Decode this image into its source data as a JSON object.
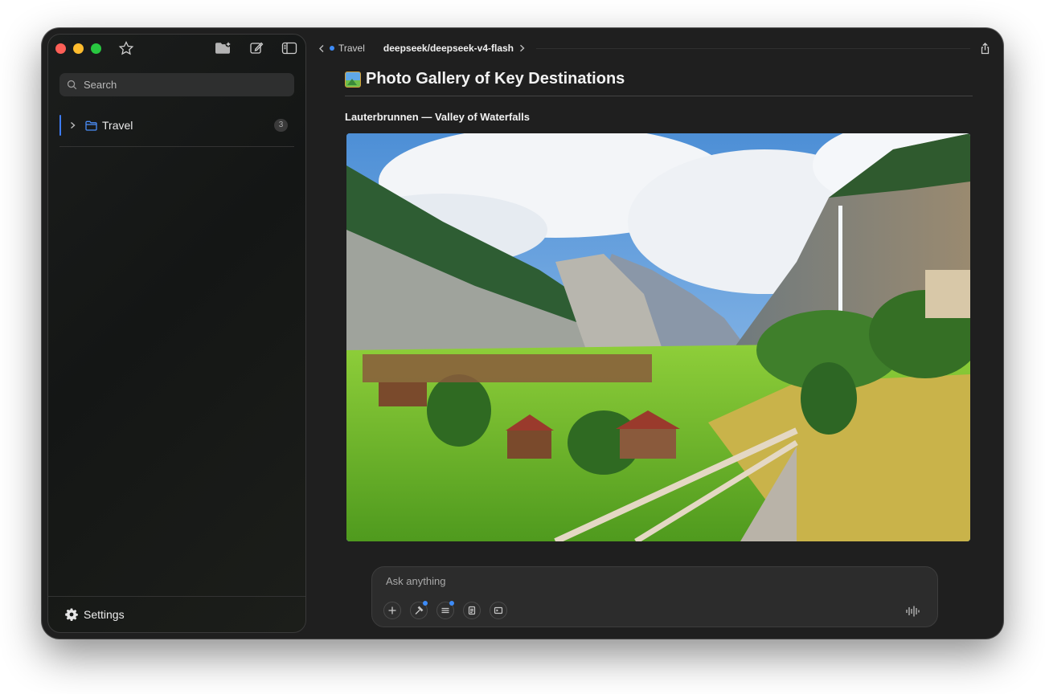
{
  "sidebar": {
    "search_placeholder": "Search",
    "folders": [
      {
        "label": "Travel",
        "count": "3"
      }
    ],
    "settings_label": "Settings"
  },
  "topbar": {
    "breadcrumb": "Travel",
    "model": "deepseek/deepseek-v4-flash"
  },
  "content": {
    "heading": "Photo Gallery of Key Destinations",
    "subheading": "Lauterbrunnen — Valley of Waterfalls"
  },
  "composer": {
    "placeholder": "Ask anything"
  },
  "colors": {
    "accent": "#3d8bf7",
    "close": "#fe5f57",
    "minimize": "#febc2e",
    "maximize": "#28c840"
  }
}
